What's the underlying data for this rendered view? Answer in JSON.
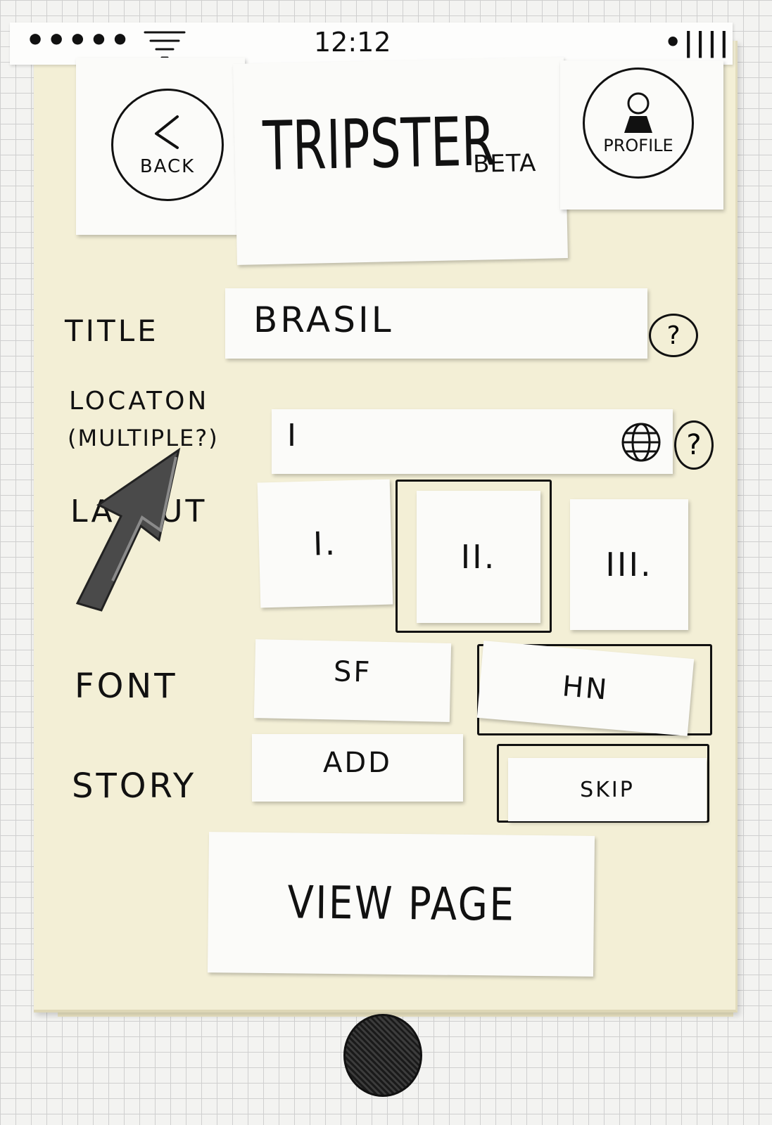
{
  "status_bar": {
    "signal_dots": "•••••",
    "time": "12:12",
    "battery": "•||||"
  },
  "header": {
    "back_label": "BACK",
    "app_title": "TRIPSTER",
    "beta_tag": "BETA",
    "profile_label": "PROFILE"
  },
  "form": {
    "title_label": "TITLE",
    "title_value": "BRASIL",
    "location_label": "LOCATON",
    "location_sublabel": "(MULTIPLE?)",
    "location_value": "I",
    "layout_label": "LAYOUT",
    "layout_options": [
      "I.",
      "II.",
      "III."
    ],
    "layout_selected": "II.",
    "font_label": "FONT",
    "font_options": [
      "SF",
      "HN"
    ],
    "font_selected": "HN",
    "story_label": "STORY",
    "story_options": [
      "ADD",
      "SKIP"
    ],
    "story_selected": "SKIP",
    "help_icon_text": "?"
  },
  "actions": {
    "view_page_label": "VIEW PAGE"
  },
  "icons": {
    "help": "question-circle-icon",
    "globe": "globe-icon",
    "back": "chevron-left-icon",
    "profile": "user-icon",
    "cursor": "arrow-cursor-icon",
    "home": "home-button"
  }
}
